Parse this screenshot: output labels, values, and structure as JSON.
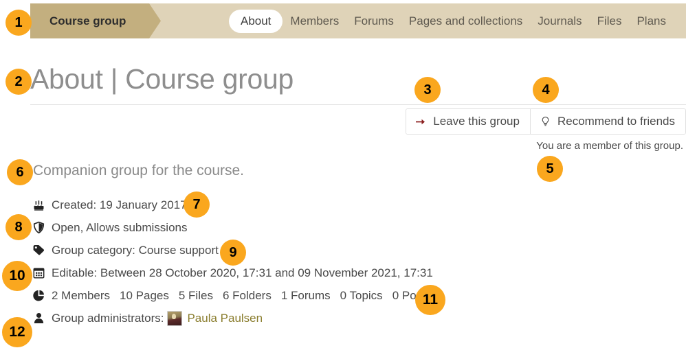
{
  "header": {
    "group_tab_label": "Course group",
    "nav_items": [
      {
        "label": "About",
        "active": true
      },
      {
        "label": "Members",
        "active": false
      },
      {
        "label": "Forums",
        "active": false
      },
      {
        "label": "Pages and collections",
        "active": false
      },
      {
        "label": "Journals",
        "active": false
      },
      {
        "label": "Files",
        "active": false
      },
      {
        "label": "Plans",
        "active": false
      }
    ]
  },
  "page": {
    "title": "About | Course group"
  },
  "actions": {
    "leave_group_label": "Leave this group",
    "leave_group_icon": "arrow-right-icon",
    "recommend_label": "Recommend to friends",
    "recommend_icon": "lightbulb-icon",
    "membership_note": "You are a member of this group."
  },
  "about": {
    "description": "Companion group for the course.",
    "rows": [
      {
        "icon": "birthday-cake-icon",
        "text": "Created: 19 January 2017"
      },
      {
        "icon": "shield-icon",
        "text": "Open, Allows submissions"
      },
      {
        "icon": "tag-icon",
        "text": "Group category: Course support"
      },
      {
        "icon": "calendar-icon",
        "text": "Editable: Between 28 October 2020, 17:31 and 09 November 2021, 17:31"
      }
    ],
    "stats_icon": "pie-chart-icon",
    "stats": [
      "2 Members",
      "10 Pages",
      "5 Files",
      "6 Folders",
      "1 Forums",
      "0 Topics",
      "0 Posts"
    ],
    "admins_icon": "person-icon",
    "admins_label": "Group administrators:",
    "admin_name": "Paula Paulsen"
  },
  "callouts": [
    {
      "n": "1"
    },
    {
      "n": "2"
    },
    {
      "n": "3"
    },
    {
      "n": "4"
    },
    {
      "n": "5"
    },
    {
      "n": "6"
    },
    {
      "n": "7"
    },
    {
      "n": "8"
    },
    {
      "n": "9"
    },
    {
      "n": "10"
    },
    {
      "n": "11"
    },
    {
      "n": "12"
    }
  ],
  "colors": {
    "badge": "#FAA71E",
    "header_light": "#DFD3B8",
    "header_tab": "#C3AF7F",
    "link": "#8A7D2E",
    "arrow": "#8B2020"
  }
}
